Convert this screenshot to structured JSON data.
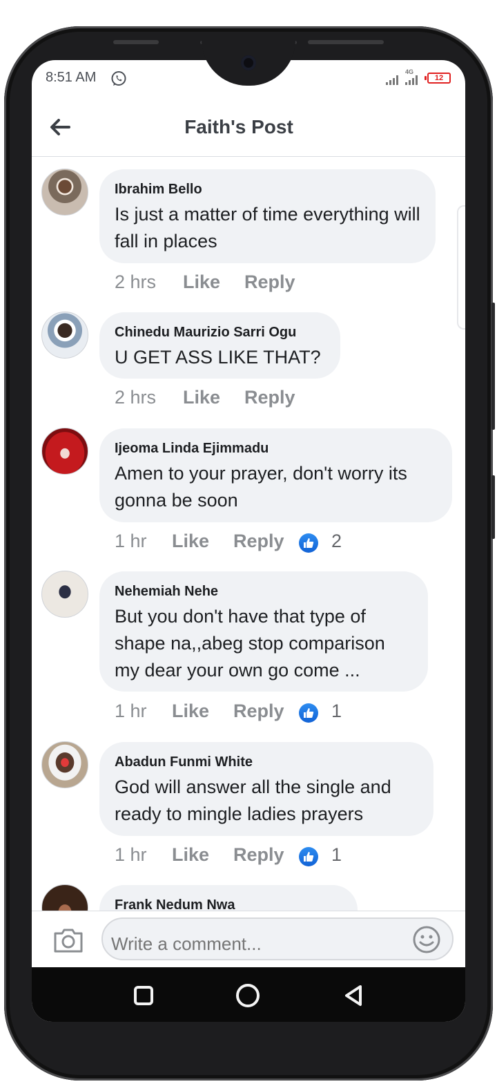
{
  "status_bar": {
    "time": "8:51 AM",
    "network": "4G",
    "battery": "12"
  },
  "header": {
    "title": "Faith's Post",
    "back_icon": "arrow-left-icon"
  },
  "comments": [
    {
      "author": "Ibrahim Bello",
      "text": "Is just a matter of time everything will fall in places",
      "time": "2 hrs",
      "like_label": "Like",
      "reply_label": "Reply",
      "reactions": ""
    },
    {
      "author": "Chinedu Maurizio Sarri Ogu",
      "text": "U GET ASS LIKE THAT?",
      "time": "2 hrs",
      "like_label": "Like",
      "reply_label": "Reply",
      "reactions": ""
    },
    {
      "author": "Ijeoma Linda Ejimmadu",
      "text": "Amen to your prayer, don't worry its gonna be soon",
      "time": "1 hr",
      "like_label": "Like",
      "reply_label": "Reply",
      "reactions": "2"
    },
    {
      "author": "Nehemiah Nehe",
      "text": "But you don't have that type of shape na,,abeg stop comparison my dear your own go come ...",
      "time": "1 hr",
      "like_label": "Like",
      "reply_label": "Reply",
      "reactions": "1"
    },
    {
      "author": "Abadun Funmi White",
      "text": "God will answer all the single and ready to mingle ladies prayers",
      "time": "1 hr",
      "like_label": "Like",
      "reply_label": "Reply",
      "reactions": "1"
    },
    {
      "author": "Frank Nedum Nwa"
    }
  ],
  "compose": {
    "placeholder": "Write a comment...",
    "camera_icon": "camera-icon",
    "emoji_icon": "emoji-icon"
  },
  "colors": {
    "accent": "#1877f2",
    "bubble": "#f0f2f5",
    "meta_text": "#8a8d91",
    "battery_low": "#e02020"
  }
}
